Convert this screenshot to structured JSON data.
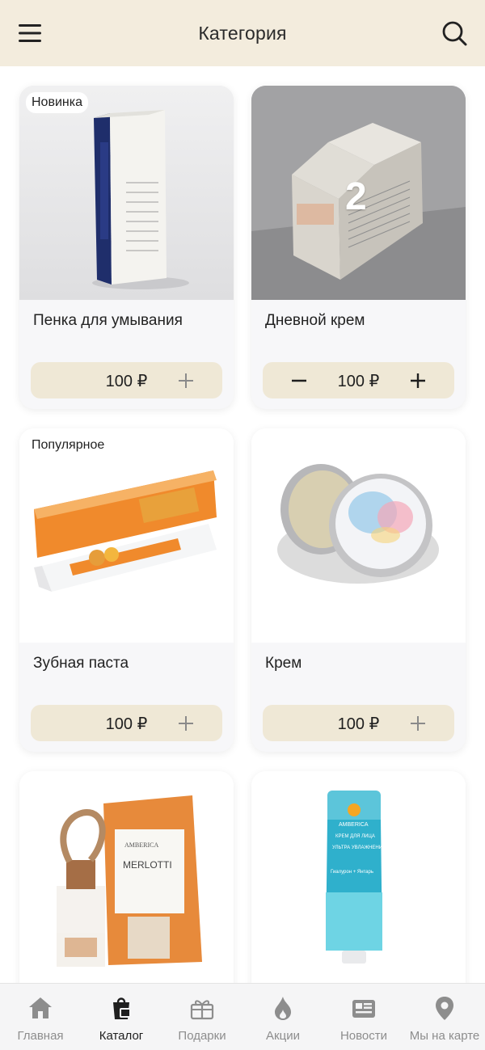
{
  "header": {
    "title": "Категория"
  },
  "products": [
    {
      "name": "Пенка для умывания",
      "price": "100 ₽",
      "badge": "Новинка"
    },
    {
      "name": "Дневной крем",
      "price": "100 ₽",
      "quantity": "2"
    },
    {
      "name": "Зубная паста",
      "price": "100 ₽",
      "badge": "Популярное"
    },
    {
      "name": "Крем",
      "price": "100 ₽"
    },
    {
      "label1": "AMBERICA",
      "label2": "MERLOTTI"
    },
    {
      "label1": "AMBERICA",
      "label2": "КРЕМ ДЛЯ ЛИЦА",
      "label3": "УЛЬТРА УВЛАЖНЕНИЕ",
      "label4": "Гиалурон + Янтарь"
    }
  ],
  "tabs": [
    {
      "label": "Главная",
      "icon": "home-icon"
    },
    {
      "label": "Каталог",
      "icon": "catalog-bag-icon"
    },
    {
      "label": "Подарки",
      "icon": "gift-icon"
    },
    {
      "label": "Акции",
      "icon": "flame-icon"
    },
    {
      "label": "Новости",
      "icon": "news-icon"
    },
    {
      "label": "Мы на карте",
      "icon": "map-pin-icon"
    }
  ],
  "colors": {
    "header_bg": "#f3ecdd",
    "price_bar_bg": "#efe8d6",
    "tab_active": "#1f1f1f",
    "tab_inactive": "#8d8d8d"
  }
}
